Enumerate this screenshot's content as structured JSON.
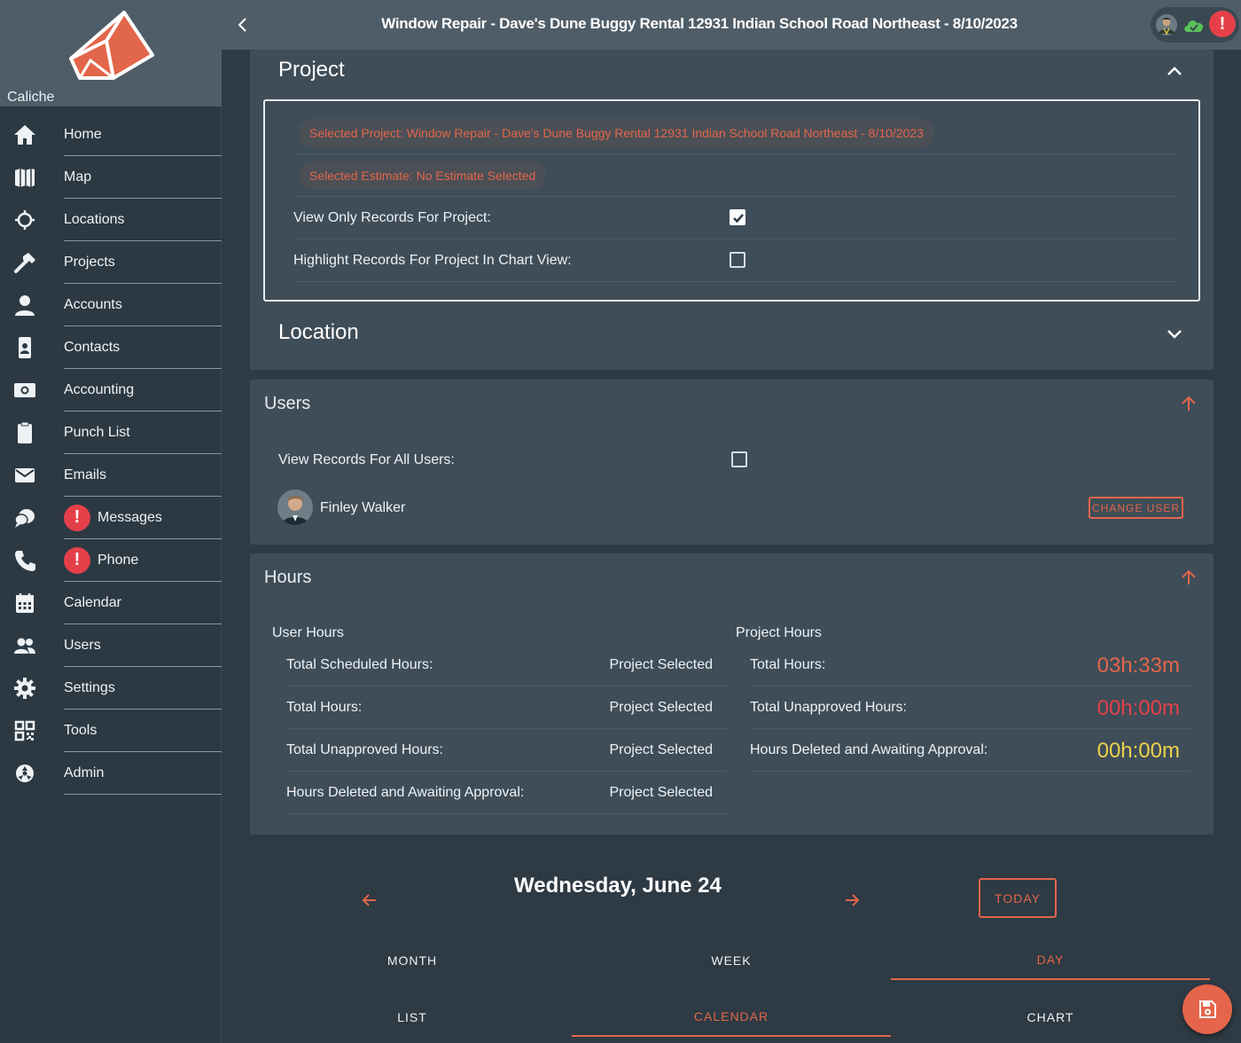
{
  "app": {
    "org_name": "Caliche"
  },
  "header": {
    "title": "Window Repair - Dave's Dune Buggy Rental 12931 Indian School Road Northeast - 8/10/2023",
    "alert_glyph": "!"
  },
  "nav": [
    {
      "label": "Home",
      "icon": "home-icon"
    },
    {
      "label": "Map",
      "icon": "map-icon"
    },
    {
      "label": "Locations",
      "icon": "crosshair-icon"
    },
    {
      "label": "Projects",
      "icon": "hammer-icon"
    },
    {
      "label": "Accounts",
      "icon": "person-icon"
    },
    {
      "label": "Contacts",
      "icon": "contact-card-icon"
    },
    {
      "label": "Accounting",
      "icon": "money-icon"
    },
    {
      "label": "Punch List",
      "icon": "clipboard-icon"
    },
    {
      "label": "Emails",
      "icon": "envelope-icon"
    },
    {
      "label": "Messages",
      "icon": "chat-icon",
      "alert": "!"
    },
    {
      "label": "Phone",
      "icon": "phone-icon",
      "alert": "!"
    },
    {
      "label": "Calendar",
      "icon": "calendar-icon"
    },
    {
      "label": "Users",
      "icon": "users-icon"
    },
    {
      "label": "Settings",
      "icon": "gear-icon"
    },
    {
      "label": "Tools",
      "icon": "qr-code-icon"
    },
    {
      "label": "Admin",
      "icon": "admin-icon"
    }
  ],
  "project": {
    "title": "Project",
    "selected_project": "Selected Project: Window Repair - Dave's Dune Buggy Rental 12931 Indian School Road Northeast - 8/10/2023",
    "selected_estimate": "Selected Estimate: No Estimate Selected",
    "view_only_label": "View Only Records For Project:",
    "view_only_checked": true,
    "highlight_label": "Highlight Records For Project In Chart View:",
    "highlight_checked": false
  },
  "location": {
    "title": "Location"
  },
  "users": {
    "title": "Users",
    "view_all_label": "View Records For All Users:",
    "view_all_checked": false,
    "user_name": "Finley Walker",
    "change_user_label": "CHANGE USER"
  },
  "hours": {
    "title": "Hours",
    "user_hours_title": "User Hours",
    "project_hours_title": "Project Hours",
    "user_rows": [
      {
        "label": "Total Scheduled Hours:",
        "value": "Project Selected"
      },
      {
        "label": "Total Hours:",
        "value": "Project Selected"
      },
      {
        "label": "Total Unapproved Hours:",
        "value": "Project Selected"
      },
      {
        "label": "Hours Deleted and Awaiting Approval:",
        "value": "Project Selected"
      }
    ],
    "project_rows": [
      {
        "label": "Total Hours:",
        "value": "03h:33m",
        "color": "#e2664a"
      },
      {
        "label": "Total Unapproved Hours:",
        "value": "00h:00m",
        "color": "#e5404a"
      },
      {
        "label": "Hours Deleted and Awaiting Approval:",
        "value": "00h:00m",
        "color": "#ecd24b"
      }
    ]
  },
  "calendar": {
    "date": "Wednesday, June 24",
    "today_label": "TODAY",
    "view_tabs": [
      "MONTH",
      "WEEK",
      "DAY"
    ],
    "active_view": "DAY",
    "mode_tabs": [
      "LIST",
      "CALENDAR",
      "CHART"
    ],
    "active_mode": "CALENDAR"
  },
  "colors": {
    "accent": "#e2664a",
    "alert": "#e5404a",
    "sidebar": "#2c3943",
    "card": "#3f4d58"
  }
}
